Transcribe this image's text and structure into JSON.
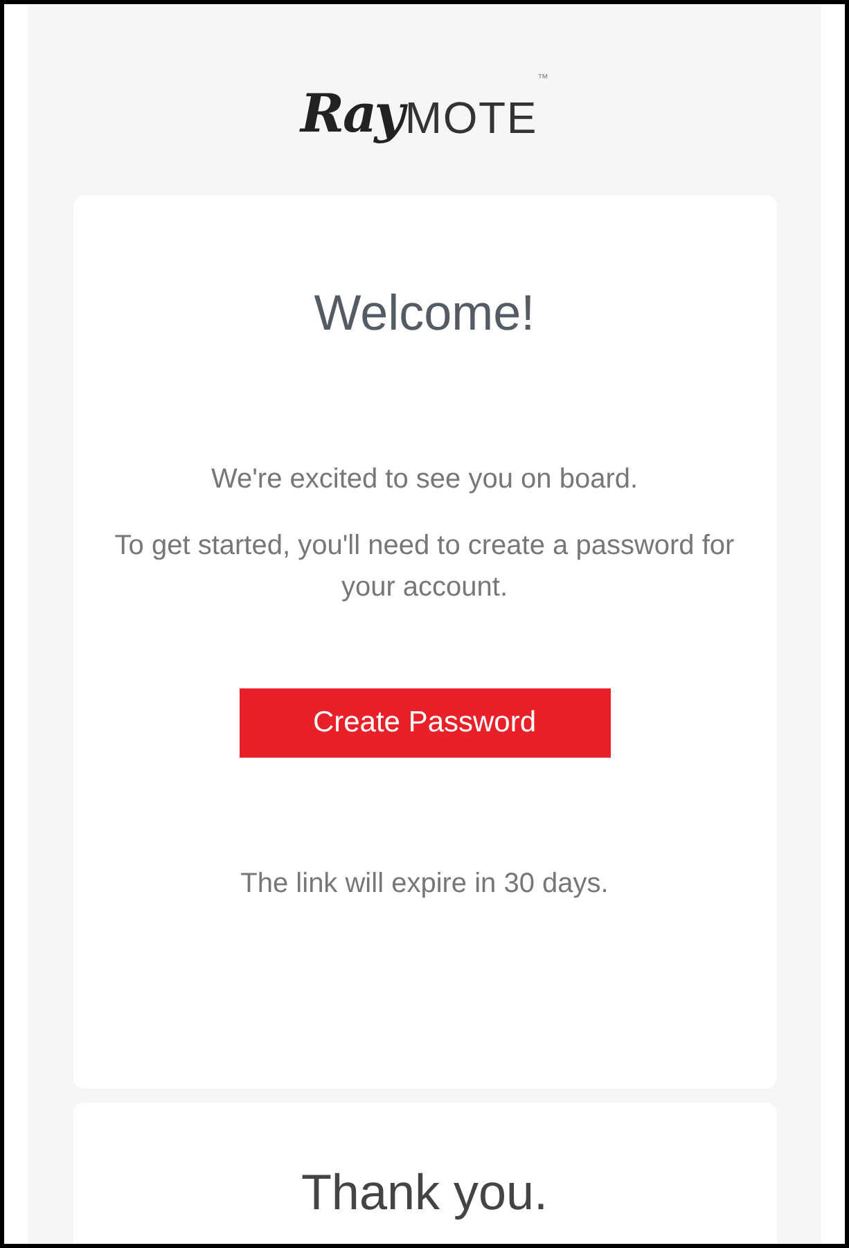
{
  "logo": {
    "part_1": "Ray",
    "part_2": "MOTE",
    "trademark": "™"
  },
  "card": {
    "title": "Welcome!",
    "paragraphs": [
      "We're excited to see you on board.",
      "To get started, you'll need to create a password for your account."
    ],
    "button": "Create Password",
    "note": "The link will expire in 30 days."
  },
  "footer": {
    "title": "Thank you."
  }
}
